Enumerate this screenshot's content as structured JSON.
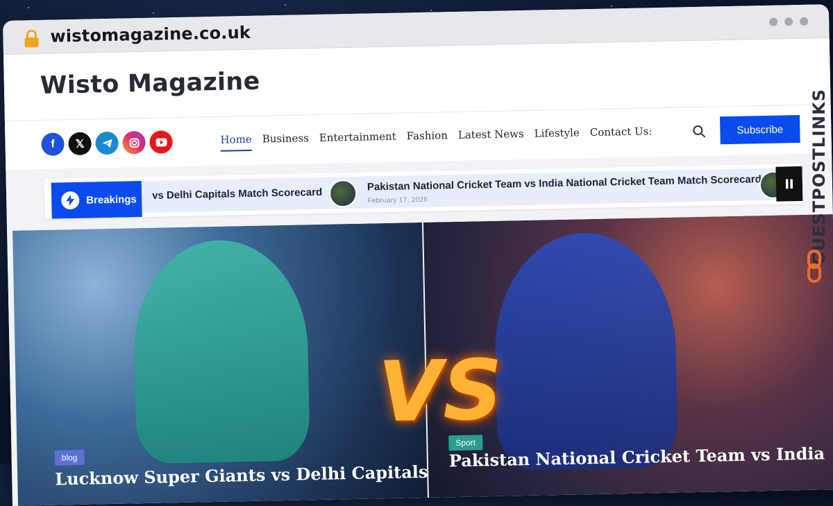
{
  "browser": {
    "url": "wistomagazine.co.uk"
  },
  "site": {
    "title": "Wisto Magazine"
  },
  "nav": {
    "items": [
      "Home",
      "Business",
      "Entertainment",
      "Fashion",
      "Latest News",
      "Lifestyle",
      "Contact Us:"
    ],
    "active": "Home",
    "subscribe_label": "Subscribe"
  },
  "socials": [
    "facebook-icon",
    "x-icon",
    "telegram-icon",
    "instagram-icon",
    "youtube-icon"
  ],
  "ticker": {
    "label": "Breakings",
    "item1": "vs Delhi Capitals Match Scorecard",
    "item2": "Pakistan National Cricket Team vs India National Cricket Team Match Scorecard",
    "item2_date": "February 17, 2026"
  },
  "hero": {
    "vs": "VS",
    "left": {
      "category": "blog",
      "title": "Lucknow Super Giants vs Delhi Capitals"
    },
    "right": {
      "category": "Sport",
      "title": "Pakistan National Cricket Team vs India"
    }
  },
  "watermark": "GUESTPOSTLINKS",
  "colors": {
    "accent": "#0a4bf0",
    "active_nav": "#1c3f9c"
  }
}
